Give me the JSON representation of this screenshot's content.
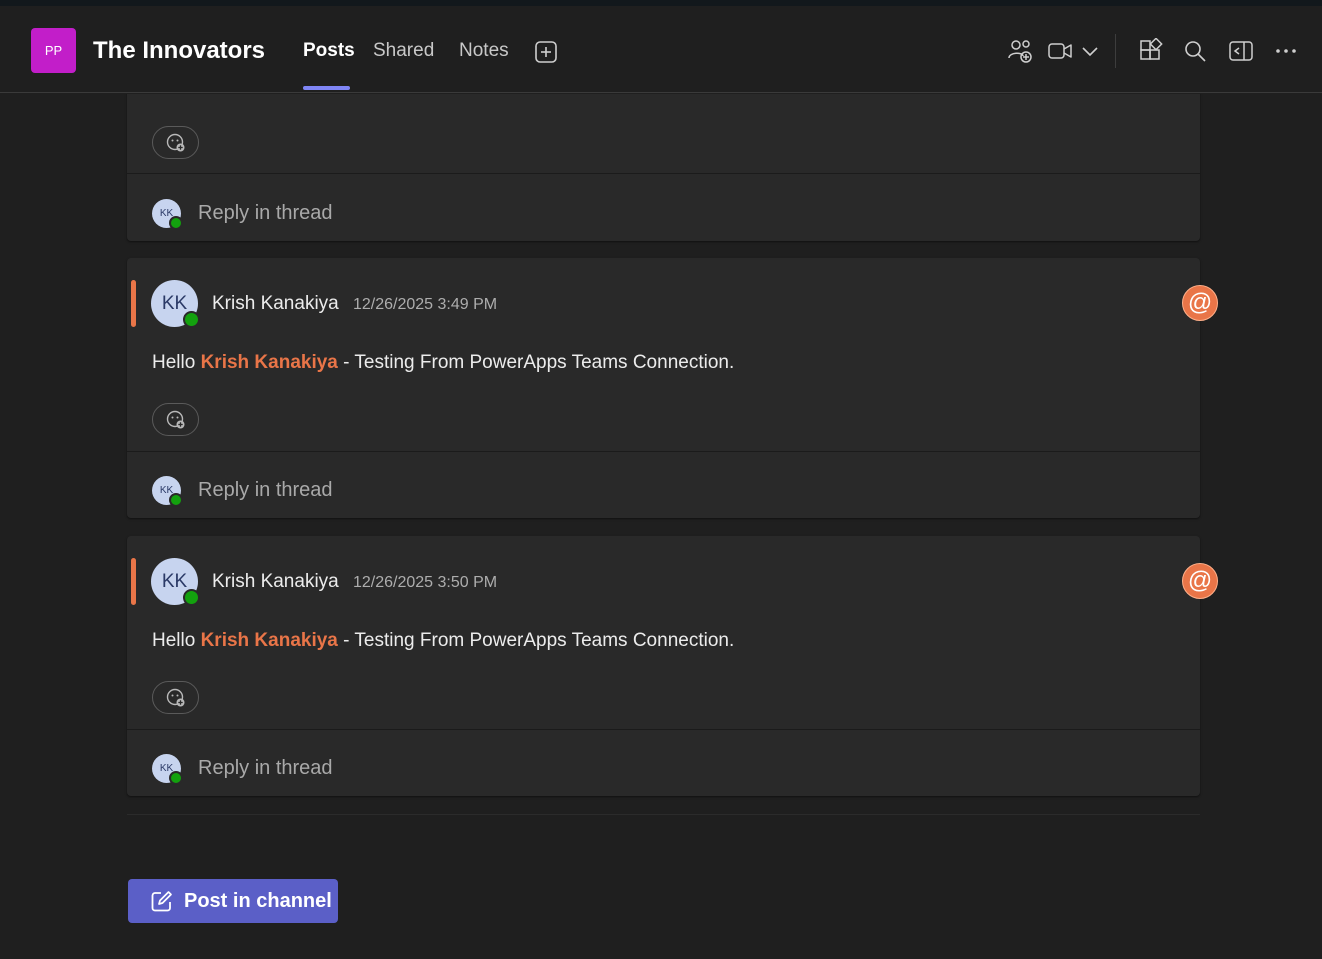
{
  "header": {
    "team_initials": "PP",
    "team_name": "The Innovators",
    "tabs": [
      {
        "label": "Posts",
        "active": true
      },
      {
        "label": "Shared",
        "active": false
      },
      {
        "label": "Notes",
        "active": false
      }
    ],
    "icons": [
      "add-tab-icon",
      "people-add-icon",
      "video-call-icon",
      "chevron-down-icon",
      "apps-icon",
      "search-icon",
      "open-side-panel-icon",
      "more-options-icon"
    ]
  },
  "colors": {
    "background": "#1f1f1f",
    "card": "#292929",
    "accent_mention": "#e97548",
    "brand_button": "#5b5fc7",
    "team_avatar": "#c21ec9",
    "presence_available": "#13a10e",
    "active_tab_underline": "#7f85f5"
  },
  "feed": {
    "partial_post": {
      "reply_label": "Reply in thread",
      "reply_avatar": "KK"
    },
    "posts": [
      {
        "avatar": "KK",
        "author": "Krish Kanakiya",
        "timestamp": "12/26/2025 3:49 PM",
        "message_prefix": "Hello ",
        "mention": "Krish Kanakiya",
        "message_suffix": " - Testing From PowerApps Teams Connection.",
        "mention_badge": "@",
        "reply_label": "Reply in thread",
        "reply_avatar": "KK"
      },
      {
        "avatar": "KK",
        "author": "Krish Kanakiya",
        "timestamp": "12/26/2025 3:50 PM",
        "message_prefix": "Hello ",
        "mention": "Krish Kanakiya",
        "message_suffix": " - Testing From PowerApps Teams Connection.",
        "mention_badge": "@",
        "reply_label": "Reply in thread",
        "reply_avatar": "KK"
      }
    ]
  },
  "post_button": {
    "label": "Post in channel"
  }
}
